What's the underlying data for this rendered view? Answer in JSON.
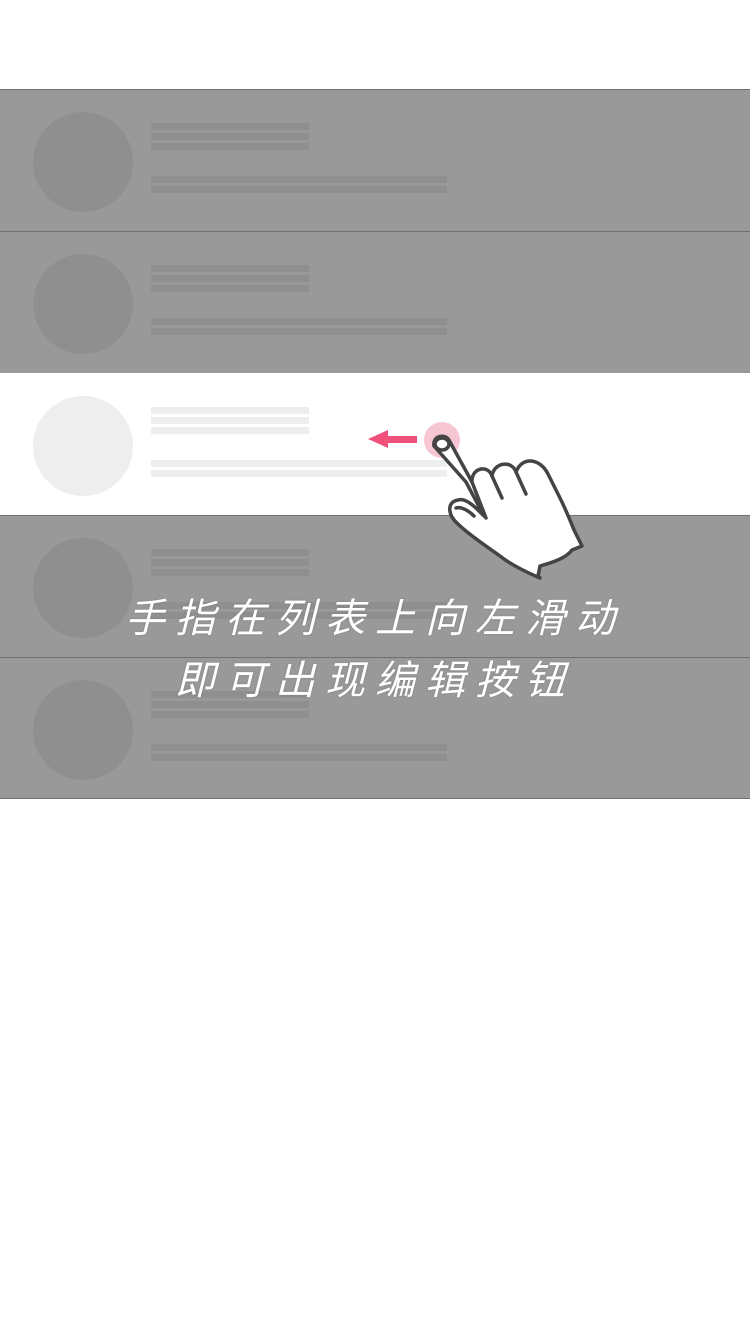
{
  "hint": {
    "line1": "手指在列表上向左滑动",
    "line2": "即可出现编辑按钮"
  },
  "colors": {
    "overlay_gray": "#999999",
    "placeholder_dark": "#8f8f8f",
    "placeholder_light": "#eeeeee",
    "arrow_pink": "#f0507a",
    "touch_pink": "#f7c6d3",
    "hand_stroke": "#444444"
  },
  "icons": {
    "gesture": "swipe-left-hand-icon",
    "arrow": "arrow-left-icon"
  }
}
